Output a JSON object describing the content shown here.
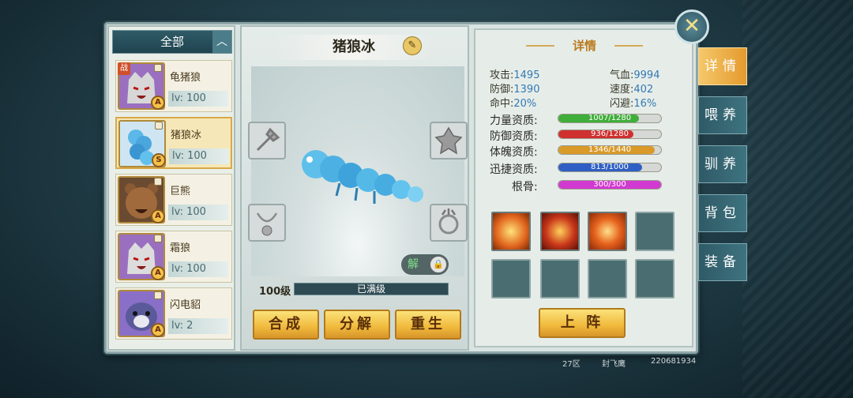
{
  "filter": {
    "label": "全部"
  },
  "pets": [
    {
      "name": "龟猪狼",
      "level": "lv: 100",
      "grade": "A",
      "battle_tag": "战",
      "selected": false,
      "portrait": "wolf-portrait"
    },
    {
      "name": "猪狼冰",
      "level": "lv: 100",
      "grade": "S",
      "selected": true,
      "portrait": "ice-worm-portrait"
    },
    {
      "name": "巨熊",
      "level": "lv: 100",
      "grade": "A",
      "selected": false,
      "portrait": "bear-portrait"
    },
    {
      "name": "霜狼",
      "level": "lv: 100",
      "grade": "A",
      "selected": false,
      "portrait": "wolf-portrait"
    },
    {
      "name": "闪电貂",
      "level": "lv: 2",
      "grade": "A",
      "selected": false,
      "portrait": "marten-portrait"
    }
  ],
  "pet_display": {
    "name": "猪狼冰",
    "level_label": "100级",
    "level_bar_text": "已满级",
    "unlock_label": "解"
  },
  "actions": {
    "combine": "合成",
    "decompose": "分解",
    "rebirth": "重生"
  },
  "details": {
    "title": "详情",
    "stats": {
      "attack_label": "攻击:",
      "attack_value": "1495",
      "hp_label": "气血:",
      "hp_value": "9994",
      "defense_label": "防御:",
      "defense_value": "1390",
      "speed_label": "速度:",
      "speed_value": "402",
      "hit_label": "命中:",
      "hit_value": "20%",
      "dodge_label": "闪避:",
      "dodge_value": "16%"
    },
    "aptitudes": [
      {
        "label": "力量资质:",
        "text": "1007/1280",
        "fraction": 0.787,
        "color": "#3fae3a"
      },
      {
        "label": "防御资质:",
        "text": "936/1280",
        "fraction": 0.731,
        "color": "#cf3030"
      },
      {
        "label": "体魄资质:",
        "text": "1346/1440",
        "fraction": 0.935,
        "color": "#d99a2a"
      },
      {
        "label": "迅捷资质:",
        "text": "813/1000",
        "fraction": 0.813,
        "color": "#2f5fc4"
      },
      {
        "label": "根骨:",
        "text": "300/300",
        "fraction": 1.0,
        "color": "#d13ad0"
      }
    ],
    "deploy_label": "上 阵"
  },
  "tabs": {
    "detail": "详情",
    "feed": "喂养",
    "train": "驯养",
    "bag": "背包",
    "equip": "装备"
  },
  "footer": {
    "zone": "27区",
    "player": "封飞鹰",
    "id": "220681934"
  },
  "colors": {
    "accent_gold": "#f0b93c",
    "panel_teal": "#2f5a66"
  }
}
